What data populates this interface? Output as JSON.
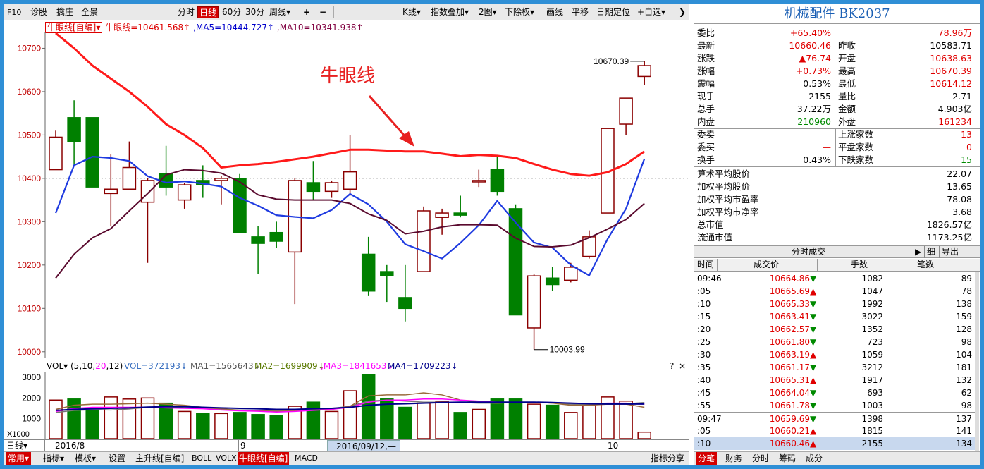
{
  "toolbar": {
    "f10": "F10",
    "diagnose": "诊股",
    "skirt": "擒庄",
    "full_view": "全景",
    "intraday": "分时",
    "daily": "日线",
    "min60": "60分",
    "min30": "30分",
    "weekly": "周线▾",
    "plus": "+",
    "minus": "−",
    "kline": "K线▾",
    "index_overlay": "指数叠加▾",
    "two_chart": "2图▾",
    "exright": "下除权▾",
    "draw": "画线",
    "pan": "平移",
    "date_locate": "日期定位",
    "watchlist": "+自选▾",
    "collapse": "❯"
  },
  "indicator": {
    "name": "牛眼线[自编]▾",
    "value": "牛眼线=10461.568↑",
    "ma5": ",MA5=10444.727↑",
    "ma10": ",MA10=10341.938↑"
  },
  "chart_data": {
    "type": "candlestick",
    "title": "",
    "ylim": [
      9985,
      10730
    ],
    "yticks": [
      10000,
      10100,
      10200,
      10300,
      10400,
      10500,
      10600,
      10700
    ],
    "ohlc": [
      [
        10420,
        10510,
        10420,
        10495
      ],
      [
        10540,
        10580,
        10430,
        10485
      ],
      [
        10540,
        10540,
        10380,
        10380
      ],
      [
        10365,
        10455,
        10290,
        10375
      ],
      [
        10375,
        10485,
        10375,
        10425
      ],
      [
        10345,
        10400,
        10205,
        10395
      ],
      [
        10410,
        10475,
        10360,
        10380
      ],
      [
        10350,
        10390,
        10330,
        10385
      ],
      [
        10395,
        10430,
        10355,
        10385
      ],
      [
        10395,
        10405,
        10340,
        10400
      ],
      [
        10400,
        10410,
        10275,
        10275
      ],
      [
        10265,
        10290,
        10180,
        10250
      ],
      [
        10275,
        10300,
        10240,
        10255
      ],
      [
        10230,
        10400,
        10110,
        10395
      ],
      [
        10390,
        10440,
        10350,
        10370
      ],
      [
        10370,
        10395,
        10355,
        10390
      ],
      [
        10375,
        10500,
        10360,
        10415
      ],
      [
        10225,
        10265,
        10130,
        10140
      ],
      [
        10185,
        10200,
        10115,
        10175
      ],
      [
        10125,
        10200,
        10070,
        10100
      ],
      [
        10185,
        10335,
        10185,
        10325
      ],
      [
        10310,
        10330,
        10270,
        10320
      ],
      [
        10320,
        10360,
        10310,
        10315
      ],
      [
        10395,
        10420,
        10380,
        10395
      ],
      [
        10420,
        10450,
        10360,
        10370
      ],
      [
        10330,
        10340,
        10085,
        10085
      ],
      [
        10055,
        10180,
        10005,
        10175
      ],
      [
        10170,
        10195,
        10140,
        10155
      ],
      [
        10165,
        10205,
        10160,
        10195
      ],
      [
        10220,
        10280,
        10215,
        10265
      ],
      [
        10320,
        10515,
        10320,
        10515
      ],
      [
        10525,
        10585,
        10500,
        10585
      ],
      [
        10635,
        10670,
        10615,
        10660
      ]
    ],
    "series": [
      {
        "name": "牛眼线",
        "values": [
          10735,
          10700,
          10660,
          10630,
          10600,
          10565,
          10525,
          10500,
          10470,
          10425,
          10430,
          10433,
          10438,
          10444,
          10450,
          10458,
          10466,
          10466,
          10464,
          10462,
          10462,
          10457,
          10451,
          10454,
          10452,
          10447,
          10433,
          10420,
          10410,
          10406,
          10414,
          10433,
          10462
        ]
      },
      {
        "name": "MA5",
        "values": [
          10320,
          10430,
          10450,
          10447,
          10440,
          10405,
          10390,
          10393,
          10388,
          10381,
          10355,
          10337,
          10315,
          10311,
          10308,
          10327,
          10364,
          10340,
          10300,
          10248,
          10232,
          10215,
          10251,
          10292,
          10348,
          10298,
          10252,
          10240,
          10200,
          10176,
          10260,
          10330,
          10445
        ]
      },
      {
        "name": "MA10",
        "values": [
          10170,
          10225,
          10263,
          10284,
          10325,
          10365,
          10408,
          10420,
          10418,
          10412,
          10392,
          10362,
          10352,
          10350,
          10350,
          10350,
          10342,
          10318,
          10303,
          10272,
          10278,
          10288,
          10293,
          10293,
          10292,
          10262,
          10243,
          10242,
          10246,
          10263,
          10283,
          10305,
          10342
        ]
      }
    ],
    "annotations": {
      "high": "10670.39",
      "low": "10003.99",
      "label": "牛眼线"
    },
    "volume": {
      "ylim": [
        0,
        3000
      ],
      "yticks": [
        1000,
        2000,
        3000
      ],
      "values": [
        1900,
        1950,
        1500,
        2050,
        1950,
        2000,
        1750,
        1350,
        1250,
        1250,
        1300,
        1200,
        1150,
        1600,
        1800,
        1350,
        2350,
        3200,
        1950,
        1550,
        1750,
        1850,
        1300,
        1450,
        1950,
        1950,
        1700,
        1650,
        1300,
        1650,
        2050,
        1850,
        350
      ],
      "ma1": [
        1300,
        1400,
        1430,
        1420,
        1470,
        1550,
        1550,
        1520,
        1500,
        1450,
        1420,
        1400,
        1380,
        1400,
        1450,
        1500,
        1600,
        1850,
        1900,
        1850,
        1800,
        1800,
        1780,
        1750,
        1750,
        1780,
        1800,
        1750,
        1700,
        1680,
        1700,
        1720,
        1780
      ],
      "ma2": [
        1450,
        1650,
        1700,
        1700,
        1720,
        1750,
        1700,
        1650,
        1550,
        1480,
        1400,
        1380,
        1350,
        1380,
        1420,
        1450,
        1600,
        2100,
        2150,
        2150,
        2250,
        2150,
        1900,
        1800,
        1750,
        1800,
        1800,
        1750,
        1650,
        1650,
        1700,
        1700,
        1550
      ],
      "ma3": [
        1350,
        1500,
        1550,
        1550,
        1550,
        1550,
        1520,
        1500,
        1480,
        1420,
        1380,
        1360,
        1320,
        1350,
        1400,
        1450,
        1550,
        1800,
        1900,
        1900,
        1950,
        1950,
        1900,
        1850,
        1800,
        1800,
        1800,
        1780,
        1750,
        1720,
        1750,
        1750,
        1700
      ],
      "ma4": [
        1400,
        1450,
        1480,
        1500,
        1520,
        1560,
        1580,
        1580,
        1550,
        1520,
        1500,
        1480,
        1450,
        1450,
        1480,
        1500,
        1550,
        1650,
        1700,
        1720,
        1750,
        1780,
        1800,
        1800,
        1800,
        1800,
        1800,
        1780,
        1750,
        1720,
        1710,
        1710,
        1710
      ]
    }
  },
  "volume": {
    "name": "VOL▾",
    "params_a": "(5,10,",
    "params_b": "20",
    "params_c": ",12)",
    "vol": "VOL=372193↓",
    "ma1": "MA1=1565643↓",
    "ma2": "MA2=1699909↓",
    "ma3": ",MA3=1841653↓",
    "ma4": "MA4=1709223↓",
    "help": "?",
    "close": "×",
    "unit": "X1000"
  },
  "dates": {
    "period": "日线▾",
    "d1": "2016/8",
    "d2": "9",
    "cursor": "2016/09/12,—",
    "d3": "10"
  },
  "bottom": {
    "common": "常用▾",
    "indicator": "指标▾",
    "template": "模板▾",
    "settings": "设置",
    "main_trend": "主升线[自编]",
    "boll": "BOLL",
    "volx": "VOLX",
    "bull_eye": "牛眼线[自编]",
    "macd": "MACD",
    "share": "指标分享"
  },
  "quote": {
    "name": "机械配件",
    "code": "BK2037",
    "rows": [
      {
        "l1": "委比",
        "v1": "+65.40%",
        "c1": "red",
        "l2": "",
        "v2": "78.96万",
        "c2": "red"
      },
      {
        "l1": "最新",
        "v1": "10660.46",
        "c1": "red",
        "l2": "昨收",
        "v2": "10583.71",
        "c2": "black"
      },
      {
        "l1": "涨跌",
        "v1": "▲76.74",
        "c1": "red",
        "l2": "开盘",
        "v2": "10638.63",
        "c2": "red"
      },
      {
        "l1": "涨幅",
        "v1": "+0.73%",
        "c1": "red",
        "l2": "最高",
        "v2": "10670.39",
        "c2": "red"
      },
      {
        "l1": "震幅",
        "v1": "0.53%",
        "c1": "black",
        "l2": "最低",
        "v2": "10614.12",
        "c2": "red"
      },
      {
        "l1": "现手",
        "v1": "2155",
        "c1": "black",
        "l2": "量比",
        "v2": "2.71",
        "c2": "black"
      },
      {
        "l1": "总手",
        "v1": "37.22万",
        "c1": "black",
        "l2": "金额",
        "v2": "4.903亿",
        "c2": "black"
      },
      {
        "l1": "内盘",
        "v1": "210960",
        "c1": "green",
        "l2": "外盘",
        "v2": "161234",
        "c2": "red"
      },
      {
        "l1": "委卖",
        "v1": "—",
        "c1": "red",
        "l2": "上涨家数",
        "v2": "13",
        "c2": "red"
      },
      {
        "l1": "委买",
        "v1": "—",
        "c1": "red",
        "l2": "平盘家数",
        "v2": "0",
        "c2": "red"
      },
      {
        "l1": "换手",
        "v1": "0.43%",
        "c1": "black",
        "l2": "下跌家数",
        "v2": "15",
        "c2": "green"
      }
    ],
    "stats": [
      {
        "label": "算术平均股价",
        "value": "22.07"
      },
      {
        "label": "加权平均股价",
        "value": "13.65"
      },
      {
        "label": "加权平均市盈率",
        "value": "78.08"
      },
      {
        "label": "加权平均市净率",
        "value": "3.68"
      },
      {
        "label": "总市值",
        "value": "1826.57亿"
      },
      {
        "label": "流通市值",
        "value": "1173.25亿"
      }
    ]
  },
  "ticks": {
    "title": "分时成交",
    "play": "▶",
    "detail": "细",
    "export": "导出",
    "cols": [
      "时间",
      "成交价",
      "手数",
      "笔数"
    ],
    "rows": [
      {
        "t": "09:46",
        "p": "10664.86",
        "d": "▼",
        "v": "1082",
        "n": "89"
      },
      {
        "t": ":05",
        "p": "10665.69",
        "d": "▲",
        "v": "1047",
        "n": "78"
      },
      {
        "t": ":10",
        "p": "10665.33",
        "d": "▼",
        "v": "1992",
        "n": "138"
      },
      {
        "t": ":15",
        "p": "10663.41",
        "d": "▼",
        "v": "3022",
        "n": "159"
      },
      {
        "t": ":20",
        "p": "10662.57",
        "d": "▼",
        "v": "1352",
        "n": "128"
      },
      {
        "t": ":25",
        "p": "10661.80",
        "d": "▼",
        "v": "723",
        "n": "98"
      },
      {
        "t": ":30",
        "p": "10663.19",
        "d": "▲",
        "v": "1059",
        "n": "104"
      },
      {
        "t": ":35",
        "p": "10661.17",
        "d": "▼",
        "v": "3212",
        "n": "181"
      },
      {
        "t": ":40",
        "p": "10665.31",
        "d": "▲",
        "v": "1917",
        "n": "132"
      },
      {
        "t": ":45",
        "p": "10664.04",
        "d": "▼",
        "v": "693",
        "n": "62"
      },
      {
        "t": ":55",
        "p": "10661.78",
        "d": "▼",
        "v": "1003",
        "n": "98"
      },
      {
        "t": "09:47",
        "p": "10659.69",
        "d": "▼",
        "v": "1398",
        "n": "137"
      },
      {
        "t": ":05",
        "p": "10660.21",
        "d": "▲",
        "v": "1815",
        "n": "141"
      },
      {
        "t": ":10",
        "p": "10660.46",
        "d": "▲",
        "v": "2155",
        "n": "134"
      }
    ]
  },
  "rbottom": [
    "分笔",
    "财务",
    "分时",
    "筹码",
    "成分"
  ],
  "colors": {
    "up": "#8b0000",
    "down": "#008000",
    "bull_eye": "#ff1a1a",
    "ma5": "#1f3be0",
    "ma10": "#5a0a2e",
    "axis_text": "#c00000"
  }
}
